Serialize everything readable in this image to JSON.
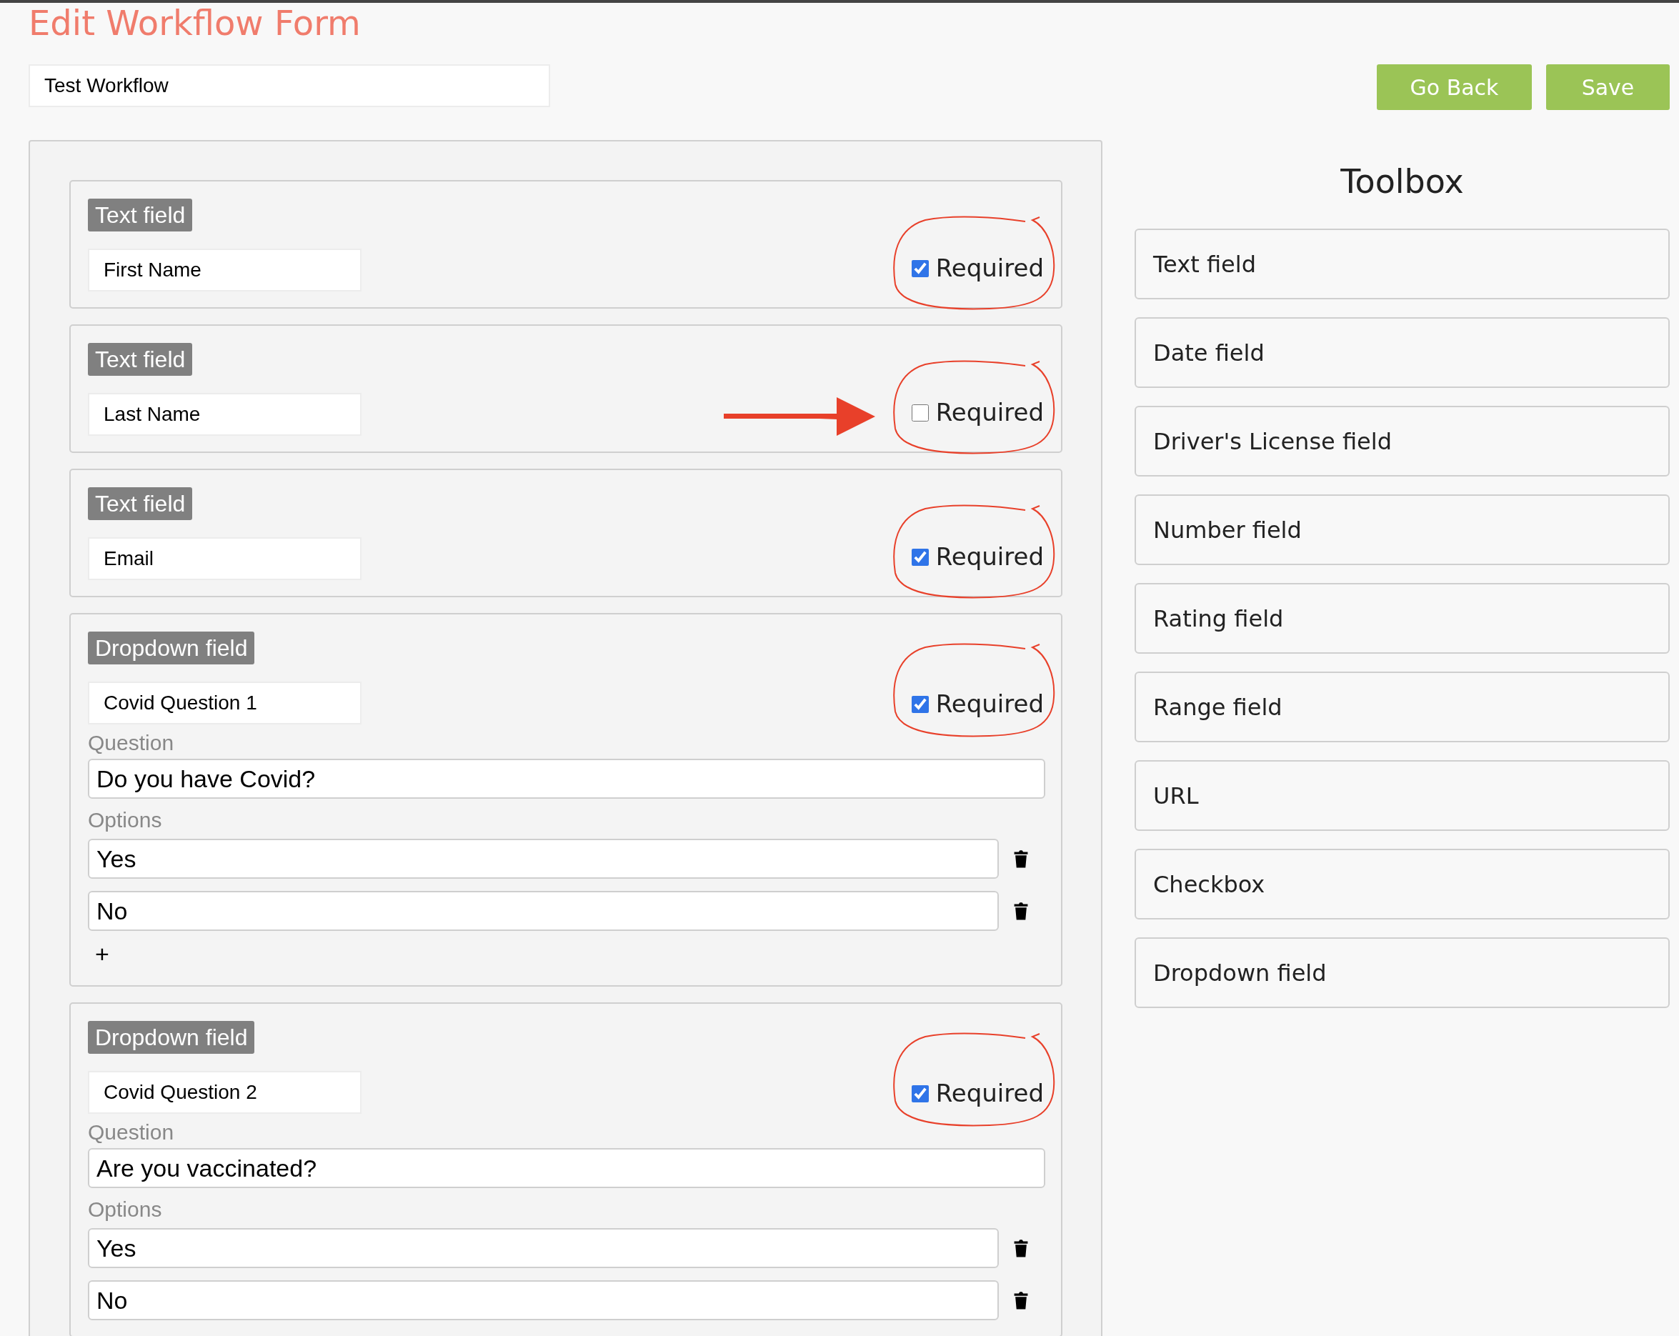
{
  "page_title": "Edit Workflow Form",
  "workflow_name": "Test Workflow",
  "buttons": [
    "Go Back",
    "Save"
  ],
  "fields": [
    {
      "kind": "text",
      "type_label": "Text field",
      "name": "First Name",
      "required_label": "Required",
      "required": true,
      "circled": true,
      "arrow": false
    },
    {
      "kind": "text",
      "type_label": "Text field",
      "name": "Last Name",
      "required_label": "Required",
      "required": false,
      "circled": true,
      "arrow": true
    },
    {
      "kind": "text",
      "type_label": "Text field",
      "name": "Email",
      "required_label": "Required",
      "required": true,
      "circled": true,
      "arrow": false
    },
    {
      "kind": "dropdown",
      "type_label": "Dropdown field",
      "name": "Covid Question 1",
      "required_label": "Required",
      "required": true,
      "circled": true,
      "arrow": false,
      "question_label": "Question",
      "question": "Do you have Covid?",
      "options_label": "Options",
      "options": [
        "Yes",
        "No"
      ],
      "add_label": "+"
    },
    {
      "kind": "dropdown",
      "type_label": "Dropdown field",
      "name": "Covid Question 2",
      "required_label": "Required",
      "required": true,
      "circled": true,
      "arrow": false,
      "question_label": "Question",
      "question": "Are you vaccinated?",
      "options_label": "Options",
      "options": [
        "Yes",
        "No"
      ]
    }
  ],
  "toolbox": {
    "title": "Toolbox",
    "items": [
      "Text field",
      "Date field",
      "Driver's License field",
      "Number field",
      "Rating field",
      "Range field",
      "URL",
      "Checkbox",
      "Dropdown field"
    ]
  }
}
